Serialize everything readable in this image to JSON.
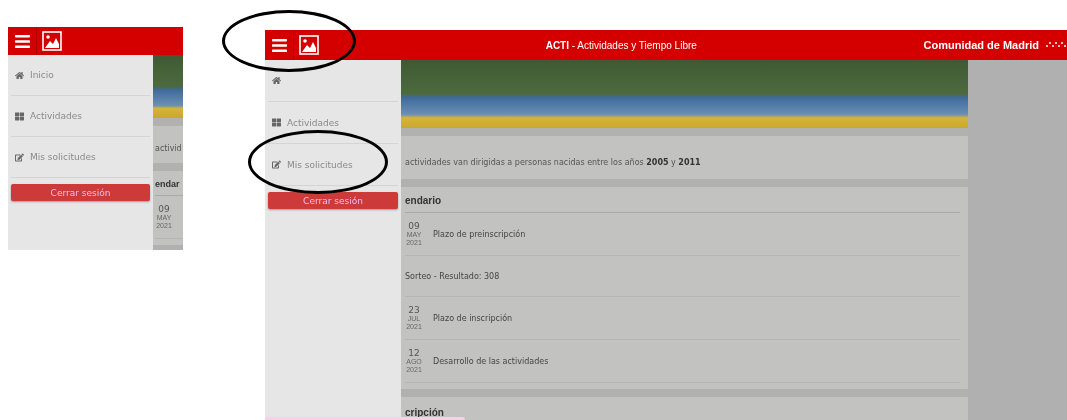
{
  "left_screenshot": {
    "menu": {
      "items": [
        {
          "kind": "home",
          "label": "Inicio"
        },
        {
          "kind": "grid",
          "label": "Actividades"
        },
        {
          "kind": "edit",
          "label": "Mis solicitudes"
        }
      ],
      "logout_button": "Cerrar sesión"
    },
    "content": {
      "intro": "activid",
      "calendar_heading": "endar",
      "events": [
        {
          "day": "09",
          "month": "MAY",
          "year": "2021"
        }
      ]
    }
  },
  "right_screenshot": {
    "header": {
      "title": "**ACTI** - Actividades y Tiempo Libre",
      "brand": "Comunidad de Madrid"
    },
    "menu": {
      "items": [
        {
          "kind": "home"
        },
        {
          "kind": "grid",
          "label": "Actividades"
        },
        {
          "kind": "edit",
          "label": "Mis solicitudes"
        }
      ],
      "logout_button": "Cerrar sesión"
    },
    "content": {
      "intro": "actividades van dirigidas a personas nacidas entre los años **2005** y **2011**",
      "calendar_heading": "endario",
      "events": [
        {
          "day": "09",
          "month": "MAY",
          "year": "2021",
          "label": "Plazo de preinscripción"
        },
        {
          "label": "Sorteo - Resultado: 308"
        },
        {
          "day": "23",
          "month": "JUL",
          "year": "2021",
          "label": "Plazo de inscripción"
        },
        {
          "day": "12",
          "month": "AGO",
          "year": "2021",
          "label": "Desarrollo de las actividades"
        }
      ],
      "next_heading": "cripción"
    }
  }
}
